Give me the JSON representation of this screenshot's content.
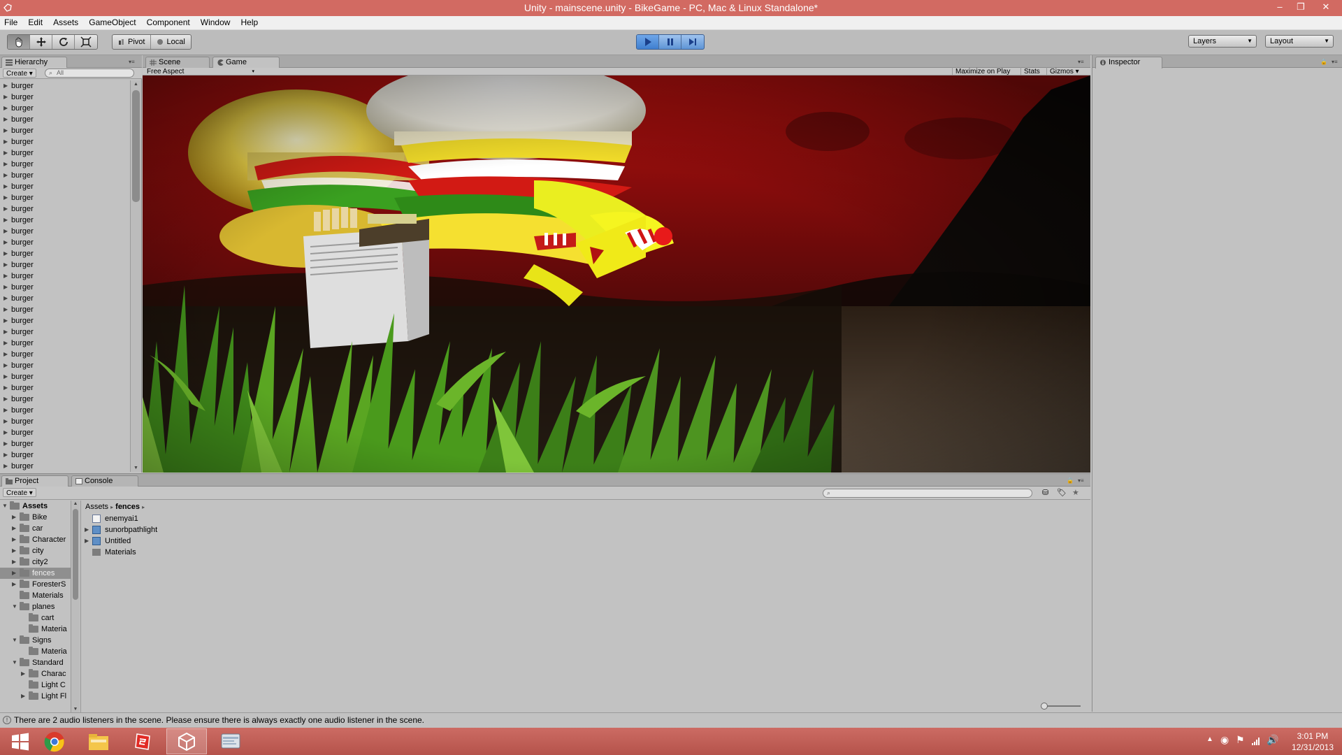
{
  "window": {
    "title": "Unity - mainscene.unity - BikeGame - PC, Mac & Linux Standalone*",
    "minimize": "–",
    "restore": "❐",
    "close": "✕"
  },
  "menu": [
    "File",
    "Edit",
    "Assets",
    "GameObject",
    "Component",
    "Window",
    "Help"
  ],
  "toolbar": {
    "transform_tools": [
      "hand-icon",
      "move-icon",
      "rotate-icon",
      "scale-icon"
    ],
    "pivot_label": "Pivot",
    "local_label": "Local",
    "play_controls": [
      "play-icon",
      "pause-icon",
      "step-icon"
    ],
    "layers_label": "Layers",
    "layout_label": "Layout",
    "play_active_color": "#4a8ee0"
  },
  "hierarchy": {
    "tab_label": "Hierarchy",
    "create_label": "Create",
    "search_placeholder": "All",
    "items": [
      "burger",
      "burger",
      "burger",
      "burger",
      "burger",
      "burger",
      "burger",
      "burger",
      "burger",
      "burger",
      "burger",
      "burger",
      "burger",
      "burger",
      "burger",
      "burger",
      "burger",
      "burger",
      "burger",
      "burger",
      "burger",
      "burger",
      "burger",
      "burger",
      "burger",
      "burger",
      "burger",
      "burger",
      "burger",
      "burger",
      "burger",
      "burger",
      "burger",
      "burger",
      "burger"
    ]
  },
  "scene_tab": {
    "label": "Scene"
  },
  "game_tab": {
    "label": "Game",
    "aspect": "Free Aspect",
    "maximize_label": "Maximize on Play",
    "stats_label": "Stats",
    "gizmos_label": "Gizmos"
  },
  "inspector": {
    "tab_label": "Inspector"
  },
  "project": {
    "tab_label": "Project",
    "console_label": "Console",
    "create_label": "Create",
    "tree": {
      "root": "Assets",
      "items": [
        {
          "label": "Bike",
          "depth": 1,
          "expander": "▶"
        },
        {
          "label": "car",
          "depth": 1,
          "expander": "▶"
        },
        {
          "label": "Character",
          "depth": 1,
          "expander": "▶"
        },
        {
          "label": "city",
          "depth": 1,
          "expander": "▶"
        },
        {
          "label": "city2",
          "depth": 1,
          "expander": "▶"
        },
        {
          "label": "fences",
          "depth": 1,
          "expander": "▶",
          "selected": true
        },
        {
          "label": "ForesterS",
          "depth": 1,
          "expander": "▶"
        },
        {
          "label": "Materials",
          "depth": 1,
          "expander": ""
        },
        {
          "label": "planes",
          "depth": 1,
          "expander": "▼"
        },
        {
          "label": "cart",
          "depth": 2,
          "expander": ""
        },
        {
          "label": "Materia",
          "depth": 2,
          "expander": ""
        },
        {
          "label": "Signs",
          "depth": 1,
          "expander": "▼"
        },
        {
          "label": "Materia",
          "depth": 2,
          "expander": ""
        },
        {
          "label": "Standard",
          "depth": 1,
          "expander": "▼"
        },
        {
          "label": "Charac",
          "depth": 2,
          "expander": "▶"
        },
        {
          "label": "Light C",
          "depth": 2,
          "expander": ""
        },
        {
          "label": "Light Fl",
          "depth": 2,
          "expander": "▶"
        }
      ]
    },
    "breadcrumb": {
      "root": "Assets",
      "current": "fences",
      "separator": "▸"
    },
    "assets": [
      {
        "label": "enemyai1",
        "type": "script",
        "expander": ""
      },
      {
        "label": "sunorbpathlight",
        "type": "prefab",
        "expander": "▶"
      },
      {
        "label": "Untitled",
        "type": "prefab",
        "expander": "▶"
      },
      {
        "label": "Materials",
        "type": "folder",
        "expander": ""
      }
    ]
  },
  "status": {
    "message": "There are 2 audio listeners in the scene. Please ensure there is always exactly one audio listener in the scene."
  },
  "taskbar": {
    "apps": [
      "windows-start-icon",
      "chrome-icon",
      "file-explorer-icon",
      "sketchup-icon",
      "unity-icon",
      "monodevelop-icon"
    ],
    "time": "3:01 PM",
    "date": "12/31/2013",
    "accent_color": "#c45d55"
  }
}
